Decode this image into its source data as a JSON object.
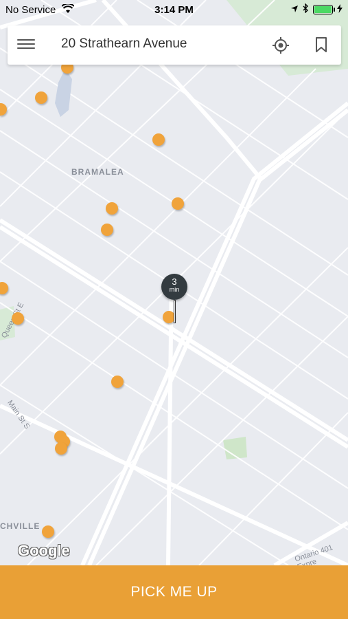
{
  "status_bar": {
    "carrier": "No Service",
    "time": "3:14 PM",
    "battery_level": 1.0
  },
  "search": {
    "address": "20 Strathearn Avenue"
  },
  "map": {
    "labels": {
      "area_1": "BRAMALEA",
      "area_2": "CHVILLE",
      "street_1": "Main St S",
      "street_2": "Queen St E",
      "highway": "Ontario 401 Expre"
    },
    "eta_pin": {
      "value": "3",
      "unit": "min"
    },
    "attribution": "Google"
  },
  "action": {
    "label": "PICK ME UP"
  },
  "colors": {
    "accent": "#e9a036",
    "marker": "#f0a33b",
    "pin": "#333b40"
  }
}
